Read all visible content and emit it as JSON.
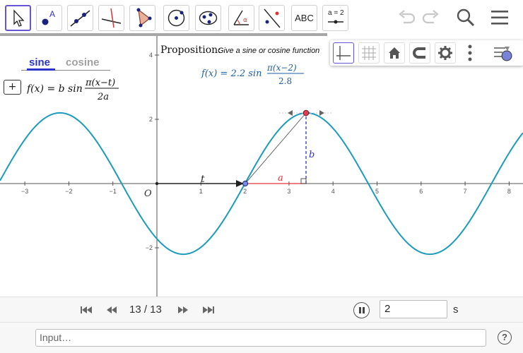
{
  "toolbar": {
    "tools": [
      {
        "icon": "move-cursor-icon",
        "active": true
      },
      {
        "icon": "point-icon",
        "label": "A"
      },
      {
        "icon": "line-icon"
      },
      {
        "icon": "perpendicular-line-icon"
      },
      {
        "icon": "polygon-icon"
      },
      {
        "icon": "circle-center-point-icon"
      },
      {
        "icon": "conic-icon"
      },
      {
        "icon": "angle-icon",
        "label": "α"
      },
      {
        "icon": "reflect-icon"
      },
      {
        "icon": "text-icon",
        "label": "ABC"
      },
      {
        "icon": "slider-icon",
        "label": "a = 2"
      }
    ]
  },
  "algebra": {
    "tab_sine": "sine",
    "tab_cosine": "cosine",
    "add_label": "+",
    "formula": "f(x) = b sin π(x−t) / 2a"
  },
  "graph": {
    "proposition_label": "Proposition:",
    "proposition_text": "Give a sine or cosine function",
    "function_label": "f(x) = 2.2 sin π(x−2) / 2.8",
    "origin_label": "O",
    "label_t": "t",
    "label_a": "a",
    "label_b": "b",
    "x_ticks": [
      "−3",
      "−2",
      "−1",
      "1",
      "2",
      "3",
      "4",
      "5",
      "6",
      "7",
      "8"
    ],
    "y_ticks": [
      "4",
      "2",
      "−2"
    ],
    "colors": {
      "curve": "#1a9bbf",
      "segment_a": "#e0303a",
      "segment_b": "#2b35c9",
      "formula": "#1e5fa8"
    }
  },
  "chart_data": {
    "type": "line",
    "series": [
      {
        "name": "f",
        "amplitude": 2.2,
        "shift": 2,
        "half_period": 2.8,
        "expr": "2.2*sin(pi*(x-2)/2.8)"
      }
    ],
    "xlim": [
      -3.5,
      8.3
    ],
    "ylim": [
      -4.6,
      4.6
    ],
    "grid": false
  },
  "navigation": {
    "step": "13 / 13",
    "speed": "2",
    "speed_unit": "s"
  },
  "input": {
    "placeholder": "Input…",
    "help": "?"
  }
}
